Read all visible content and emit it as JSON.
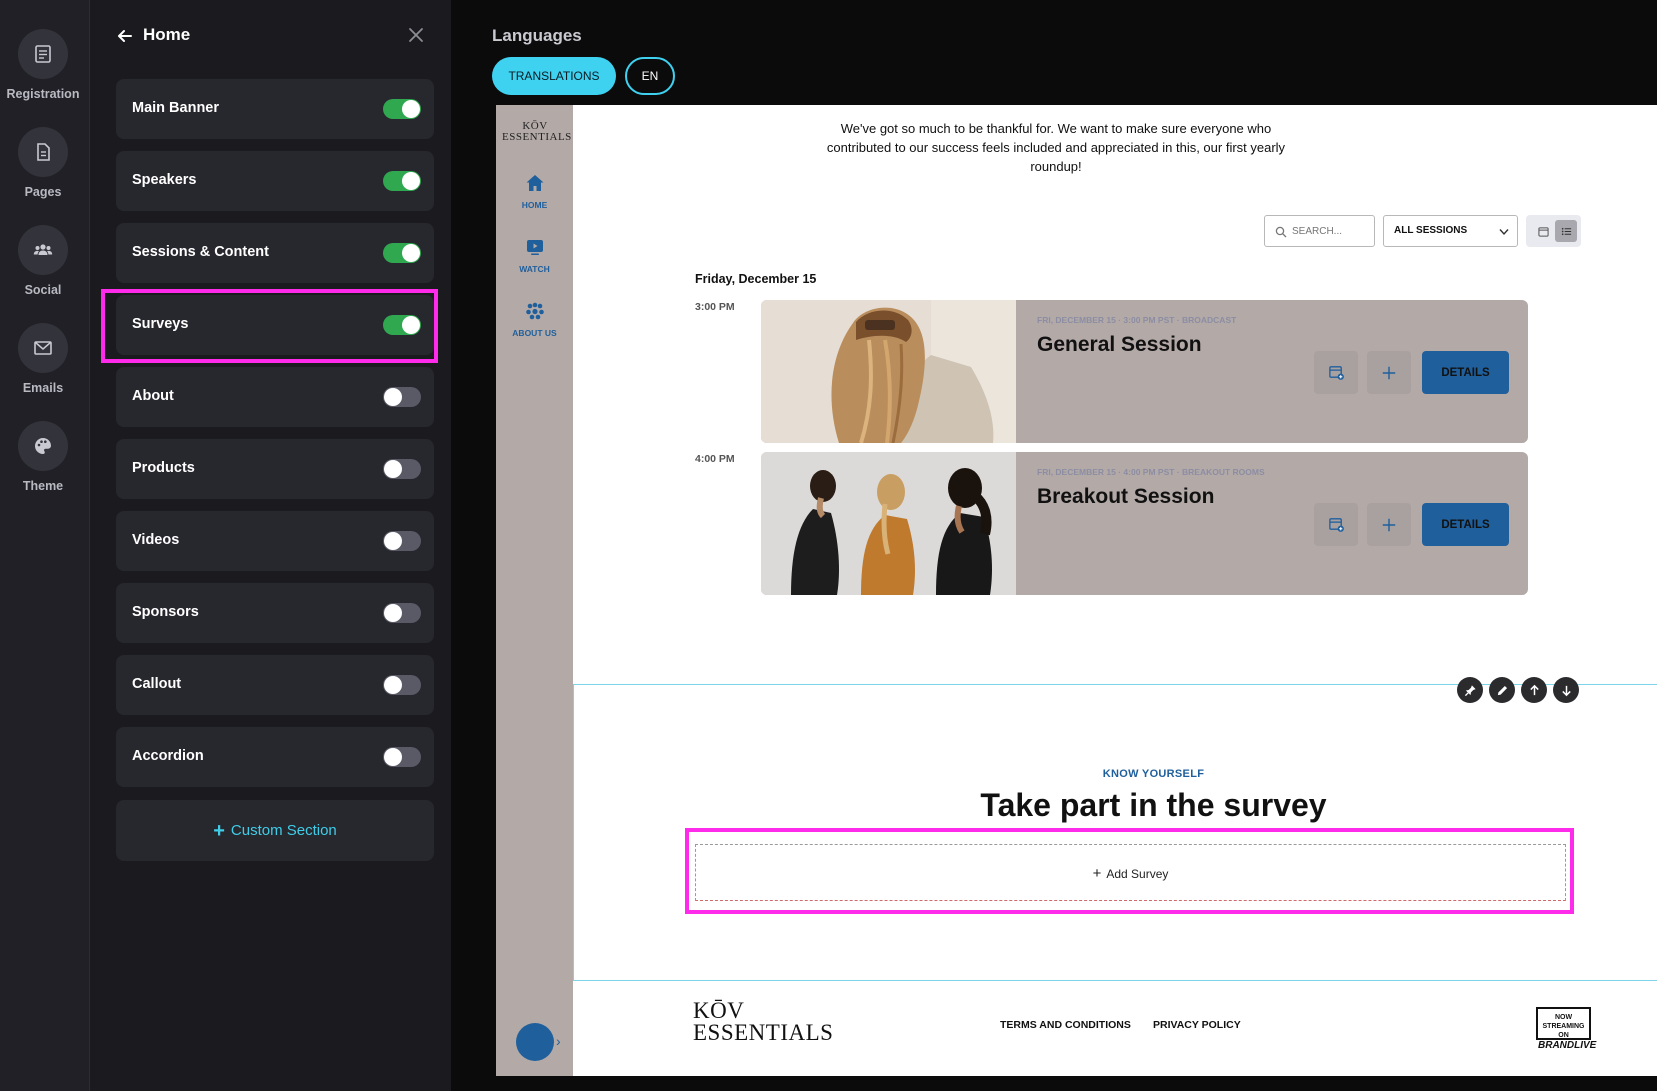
{
  "rail": {
    "items": [
      {
        "label": "Registration",
        "icon": "registration-icon"
      },
      {
        "label": "Pages",
        "icon": "pages-icon"
      },
      {
        "label": "Social",
        "icon": "social-icon"
      },
      {
        "label": "Emails",
        "icon": "emails-icon"
      },
      {
        "label": "Theme",
        "icon": "theme-icon"
      }
    ]
  },
  "panel": {
    "title": "Home",
    "sections": [
      {
        "label": "Main Banner",
        "enabled": true
      },
      {
        "label": "Speakers",
        "enabled": true
      },
      {
        "label": "Sessions & Content",
        "enabled": true
      },
      {
        "label": "Surveys",
        "enabled": true
      },
      {
        "label": "About",
        "enabled": false
      },
      {
        "label": "Products",
        "enabled": false
      },
      {
        "label": "Videos",
        "enabled": false
      },
      {
        "label": "Sponsors",
        "enabled": false
      },
      {
        "label": "Callout",
        "enabled": false
      },
      {
        "label": "Accordion",
        "enabled": false
      }
    ],
    "custom_section_label": "Custom Section"
  },
  "main": {
    "title": "Languages",
    "translations_label": "TRANSLATIONS",
    "language_label": "EN"
  },
  "preview": {
    "logo_small_line1": "KŌV",
    "logo_small_line2": "ESSENTIALS",
    "nav": [
      {
        "label": "HOME",
        "icon": "home-icon"
      },
      {
        "label": "WATCH",
        "icon": "watch-icon"
      },
      {
        "label": "ABOUT US",
        "icon": "about-us-icon"
      }
    ],
    "intro": "We've got so much to be thankful for. We want to make sure everyone who contributed to our success feels included and appreciated in this, our first yearly roundup!",
    "search_placeholder": "SEARCH...",
    "filter_value": "ALL SESSIONS",
    "date_heading": "Friday, December 15",
    "sessions": [
      {
        "time": "3:00 PM",
        "meta": "FRI, DECEMBER 15 · 3:00 PM PST · BROADCAST",
        "title": "General Session",
        "details_label": "DETAILS"
      },
      {
        "time": "4:00 PM",
        "meta": "FRI, DECEMBER 15 · 4:00 PM PST · BREAKOUT ROOMS",
        "title": "Breakout Session",
        "details_label": "DETAILS"
      }
    ],
    "survey": {
      "kicker": "KNOW YOURSELF",
      "title": "Take part in the survey",
      "add_label": "Add Survey"
    },
    "footer": {
      "logo_line1": "KŌV",
      "logo_line2": "ESSENTIALS",
      "terms": "TERMS AND CONDITIONS",
      "privacy": "PRIVACY POLICY",
      "badge_line1": "NOW STREAMING ON",
      "badge_line2": "BRANDLIVE"
    }
  },
  "colors": {
    "accent_cyan": "#3fd2f0",
    "toggle_on": "#2fa84f",
    "highlight": "#ff2bea",
    "brand_blue": "#1f5f9c"
  }
}
